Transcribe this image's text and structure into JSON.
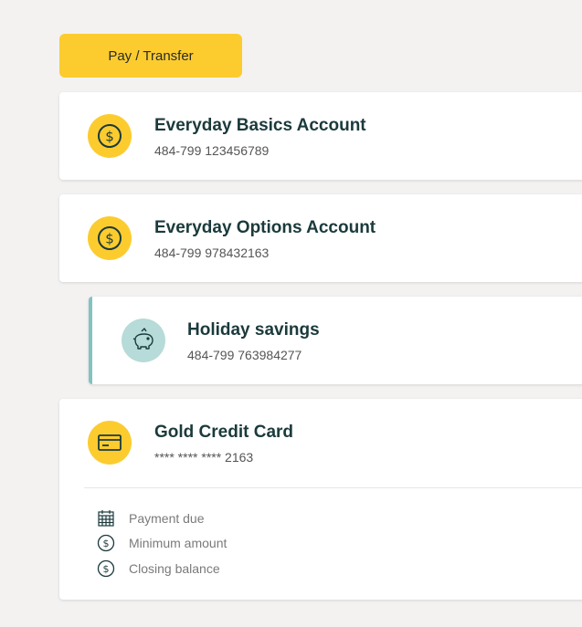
{
  "actions": {
    "pay_transfer_label": "Pay / Transfer"
  },
  "accounts": [
    {
      "name": "Everyday Basics Account",
      "number": "484-799 123456789",
      "icon": "dollar-icon"
    },
    {
      "name": "Everyday Options Account",
      "number": "484-799 978432163",
      "icon": "dollar-icon"
    },
    {
      "name": "Holiday savings",
      "number": "484-799 763984277",
      "icon": "piggy-bank-icon"
    },
    {
      "name": "Gold Credit Card",
      "number": "**** **** **** 2163",
      "icon": "credit-card-icon"
    }
  ],
  "credit_details": [
    {
      "label": "Payment due",
      "icon": "calendar-icon"
    },
    {
      "label": "Minimum amount",
      "icon": "dollar-icon"
    },
    {
      "label": "Closing balance",
      "icon": "dollar-icon"
    }
  ],
  "colors": {
    "accent_yellow": "#fccc2f",
    "savings_teal": "#82c3c0",
    "heading_dark": "#1b3a3c"
  }
}
